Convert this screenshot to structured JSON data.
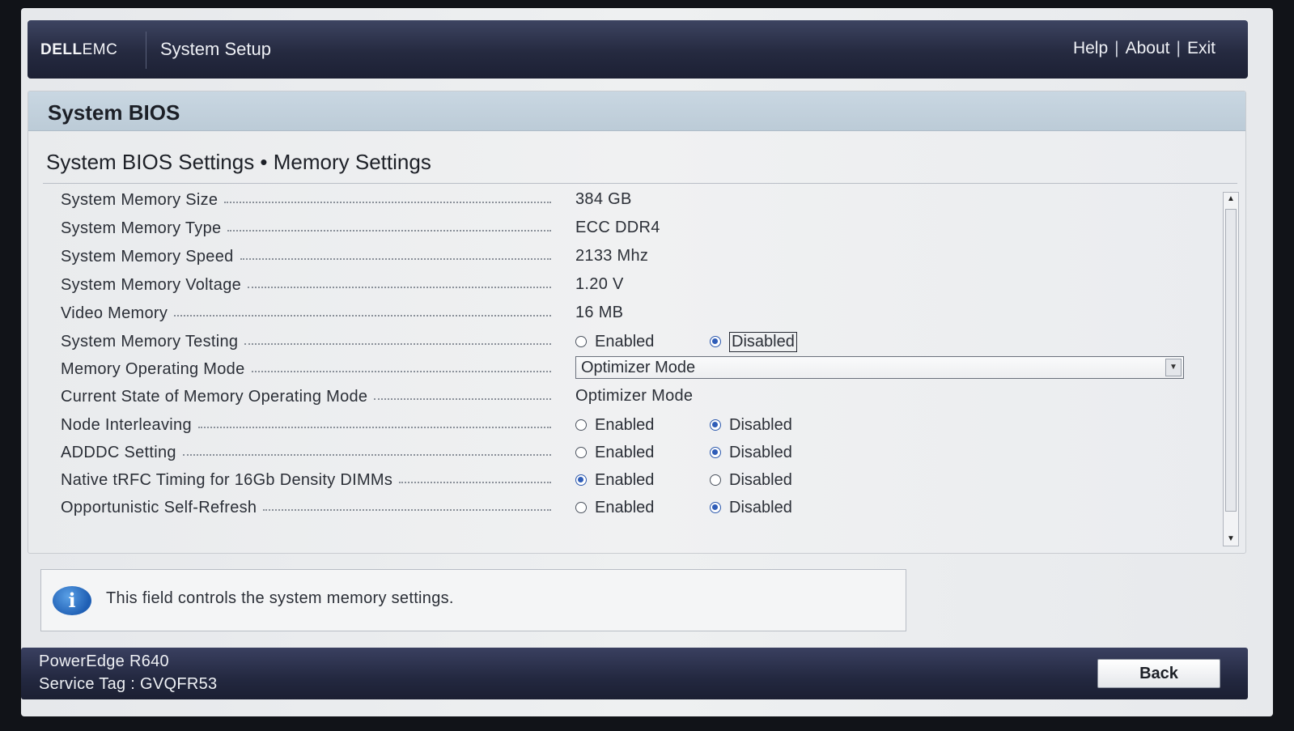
{
  "header": {
    "logo_dell": "DELL",
    "logo_emc": "EMC",
    "title": "System Setup",
    "links": [
      "Help",
      "About",
      "Exit"
    ],
    "link_separator": "|"
  },
  "panel": {
    "title": "System BIOS",
    "breadcrumb": "System BIOS Settings • Memory Settings"
  },
  "settings": {
    "memory_size": {
      "label": "System Memory Size",
      "value": "384 GB"
    },
    "memory_type": {
      "label": "System Memory Type",
      "value": "ECC DDR4"
    },
    "memory_speed": {
      "label": "System Memory Speed",
      "value": "2133 Mhz"
    },
    "memory_voltage": {
      "label": "System Memory Voltage",
      "value": "1.20 V"
    },
    "video_memory": {
      "label": "Video Memory",
      "value": "16 MB"
    },
    "memory_testing": {
      "label": "System Memory Testing",
      "enabled": "Enabled",
      "disabled": "Disabled",
      "selected": "Disabled"
    },
    "operating_mode": {
      "label": "Memory Operating Mode",
      "value": "Optimizer Mode"
    },
    "current_state": {
      "label": "Current State of Memory Operating Mode",
      "value": "Optimizer Mode"
    },
    "node_interleaving": {
      "label": "Node Interleaving",
      "enabled": "Enabled",
      "disabled": "Disabled",
      "selected": "Disabled"
    },
    "adddc": {
      "label": "ADDDC Setting",
      "enabled": "Enabled",
      "disabled": "Disabled",
      "selected": "Disabled"
    },
    "native_trfc": {
      "label": "Native tRFC Timing for 16Gb Density DIMMs",
      "enabled": "Enabled",
      "disabled": "Disabled",
      "selected": "Enabled"
    },
    "self_refresh": {
      "label": "Opportunistic Self-Refresh",
      "enabled": "Enabled",
      "disabled": "Disabled",
      "selected": "Disabled"
    }
  },
  "info": {
    "icon": "info-icon",
    "glyph": "i",
    "text": "This field controls the system memory settings."
  },
  "footer": {
    "model": "PowerEdge R640",
    "service_tag": "Service Tag : GVQFR53",
    "back_label": "Back"
  },
  "colors": {
    "header_bg": "#252a40",
    "panel_title_bg": "#c2d0dc",
    "radio_selected": "#2f5db8"
  }
}
